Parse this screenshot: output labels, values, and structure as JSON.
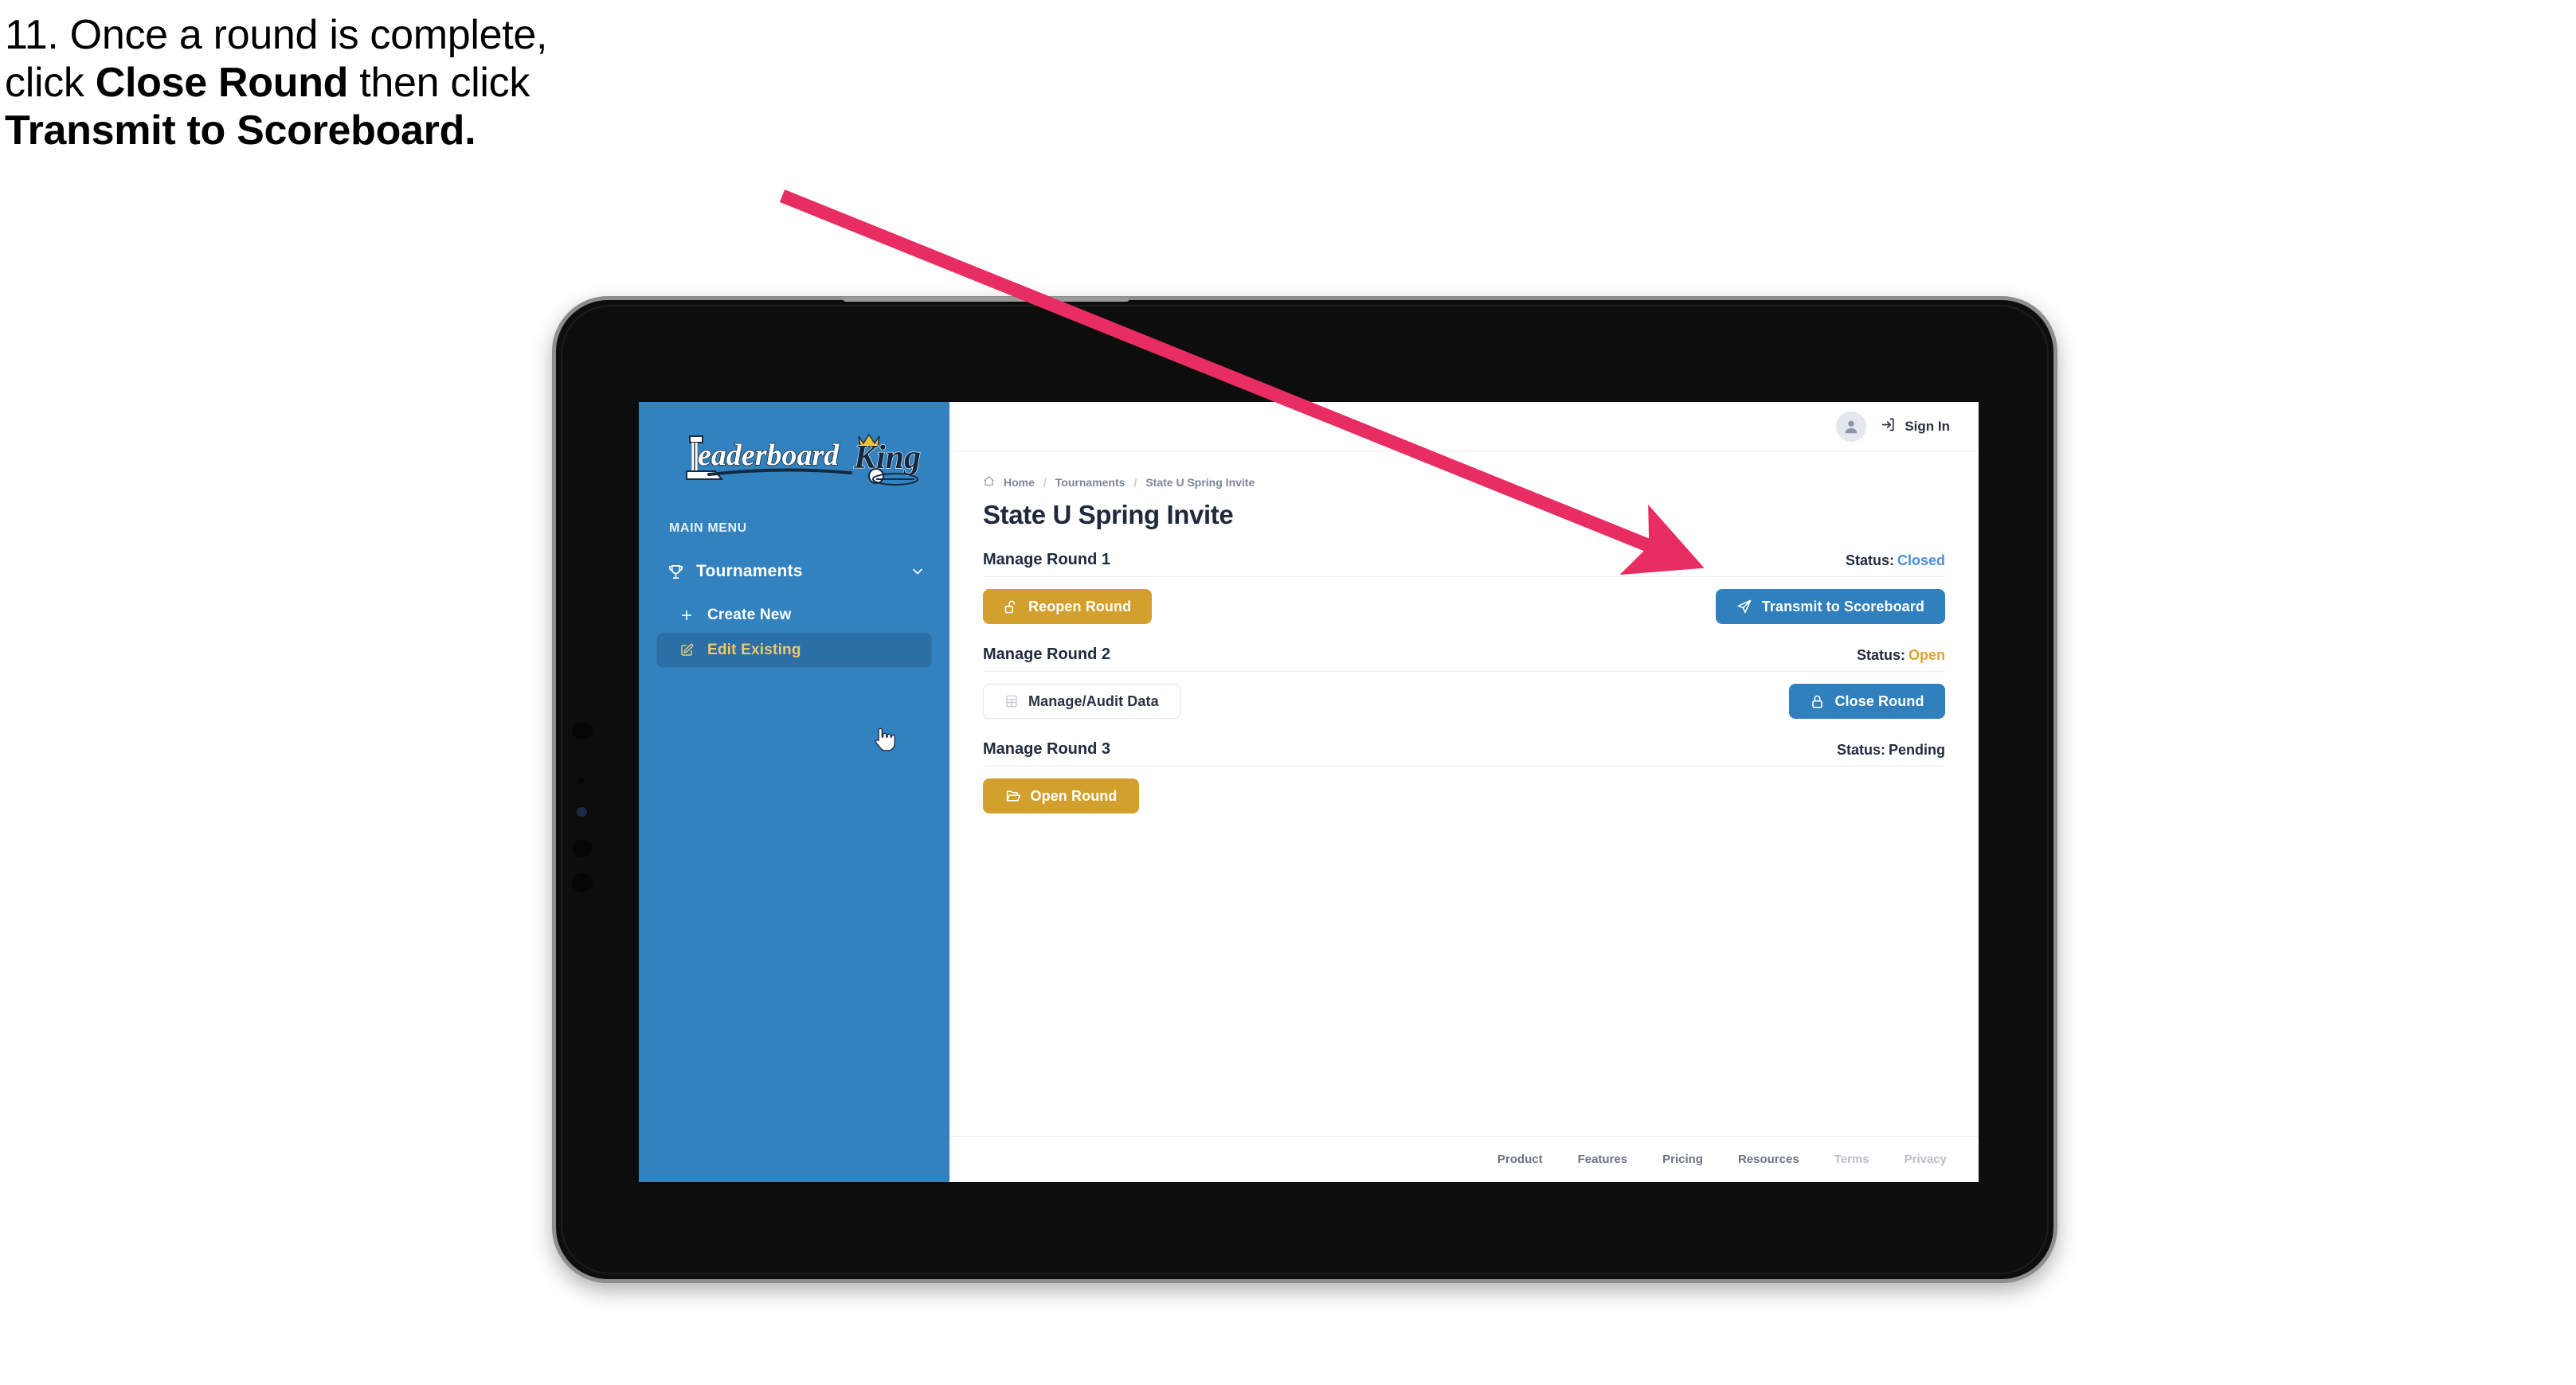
{
  "caption": {
    "line1_prefix": "11. Once a round is complete,",
    "line2_prefix": "click ",
    "line2_bold": "Close Round",
    "line2_suffix": " then click",
    "line3_bold": "Transmit to Scoreboard."
  },
  "annotation": {
    "arrow_color": "#E82D63",
    "points_to": "transmit-to-scoreboard-button"
  },
  "sidebar": {
    "logo_text_primary": "Leaderboard",
    "logo_text_secondary": "King",
    "section_label": "MAIN MENU",
    "nav": {
      "label": "Tournaments",
      "icon": "trophy-icon",
      "chevron": "chevron-down-icon"
    },
    "items": [
      {
        "label": "Create New",
        "icon": "plus-icon",
        "active": false
      },
      {
        "label": "Edit Existing",
        "icon": "edit-square-icon",
        "active": true
      }
    ],
    "bg_color": "#3282BF",
    "active_bg_color": "#2A6FA6",
    "active_text_color": "#F0C869"
  },
  "topbar": {
    "avatar_icon": "user-avatar-icon",
    "signin_icon": "sign-in-arrow-icon",
    "signin_label": "Sign In"
  },
  "breadcrumb": {
    "home_icon": "home-icon",
    "items": [
      "Home",
      "Tournaments",
      "State U Spring Invite"
    ],
    "separator": "/"
  },
  "page": {
    "title": "State U Spring Invite"
  },
  "rounds": [
    {
      "title": "Manage Round 1",
      "status_label": "Status:",
      "status_value": "Closed",
      "status_color": "#4A90D9",
      "left_button": {
        "label": "Reopen Round",
        "icon": "unlock-icon",
        "style": "gold"
      },
      "right_button": {
        "label": "Transmit to Scoreboard",
        "icon": "send-plane-icon",
        "style": "blue"
      }
    },
    {
      "title": "Manage Round 2",
      "status_label": "Status:",
      "status_value": "Open",
      "status_color": "#E0A32E",
      "left_button": {
        "label": "Manage/Audit Data",
        "icon": "table-grid-icon",
        "style": "ghost"
      },
      "right_button": {
        "label": "Close Round",
        "icon": "lock-icon",
        "style": "blue"
      }
    },
    {
      "title": "Manage Round 3",
      "status_label": "Status:",
      "status_value": "Pending",
      "status_color": "#222A3D",
      "left_button": {
        "label": "Open Round",
        "icon": "open-folder-icon",
        "style": "gold"
      },
      "right_button": null
    }
  ],
  "footer": {
    "links": [
      {
        "label": "Product",
        "muted": false
      },
      {
        "label": "Features",
        "muted": false
      },
      {
        "label": "Pricing",
        "muted": false
      },
      {
        "label": "Resources",
        "muted": false
      },
      {
        "label": "Terms",
        "muted": true
      },
      {
        "label": "Privacy",
        "muted": true
      }
    ]
  },
  "cursor": {
    "type": "pointing-hand-cursor"
  }
}
